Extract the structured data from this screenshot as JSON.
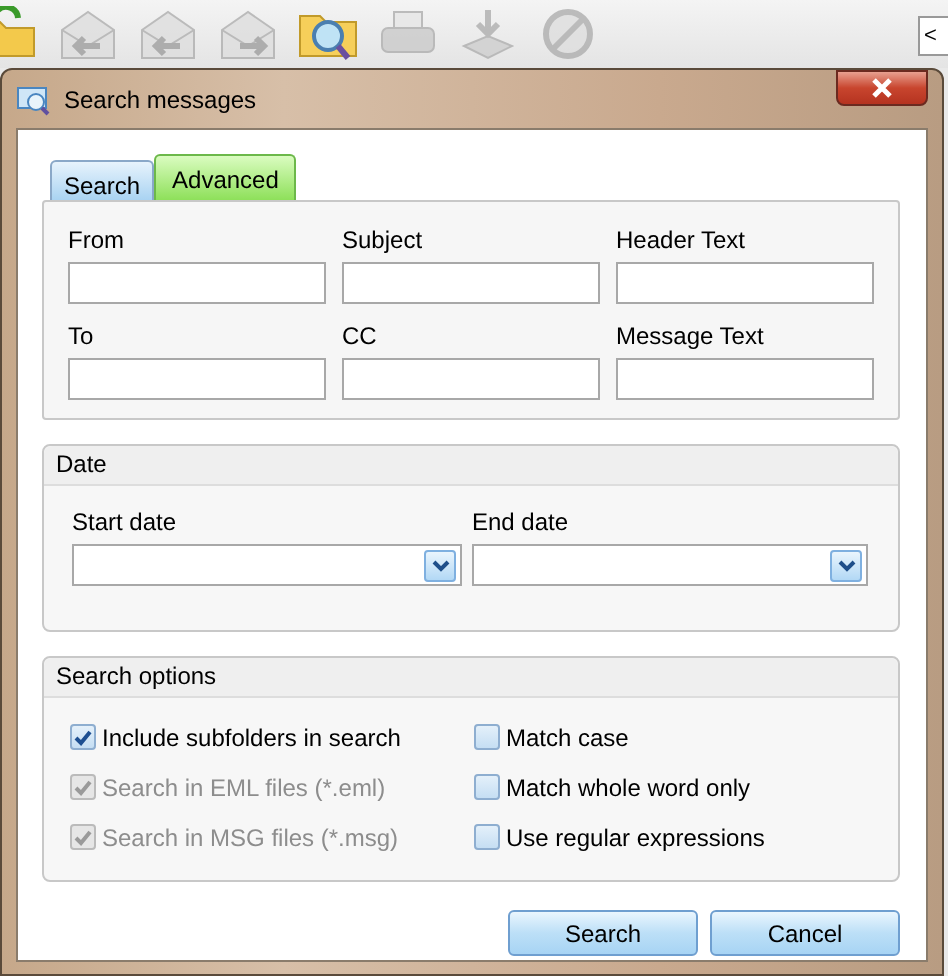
{
  "toolbar": [
    {
      "kind": "folder",
      "disabled": false
    },
    {
      "kind": "reply",
      "disabled": true
    },
    {
      "kind": "replyall",
      "disabled": true
    },
    {
      "kind": "forward",
      "disabled": true
    },
    {
      "kind": "searchfolder",
      "disabled": false
    },
    {
      "kind": "printer",
      "disabled": true
    },
    {
      "kind": "download",
      "disabled": true
    },
    {
      "kind": "blocked",
      "disabled": true
    }
  ],
  "toolbar_field": {
    "value": "<"
  },
  "window": {
    "title": "Search messages"
  },
  "tabs": [
    {
      "label": "Search",
      "selected": false
    },
    {
      "label": "Advanced",
      "selected": true
    }
  ],
  "fields": [
    {
      "label": "From"
    },
    {
      "label": "Subject"
    },
    {
      "label": "Header Text"
    },
    {
      "label": "To"
    },
    {
      "label": "CC"
    },
    {
      "label": "Message Text"
    }
  ],
  "date_group": {
    "title": "Date",
    "start_label": "Start date",
    "end_label": "End date"
  },
  "options_group": {
    "title": "Search options"
  },
  "options": [
    {
      "label": "Include subfolders in search",
      "checked": true,
      "disabled": false
    },
    {
      "label": "Match case",
      "checked": false,
      "disabled": false
    },
    {
      "label": "Search in EML files (*.eml)",
      "checked": true,
      "disabled": true
    },
    {
      "label": "Match whole word only",
      "checked": false,
      "disabled": false
    },
    {
      "label": "Search in MSG files (*.msg)",
      "checked": true,
      "disabled": true
    },
    {
      "label": "Use regular expressions",
      "checked": false,
      "disabled": false
    }
  ],
  "buttons": [
    {
      "label": "Search"
    },
    {
      "label": "Cancel"
    }
  ]
}
